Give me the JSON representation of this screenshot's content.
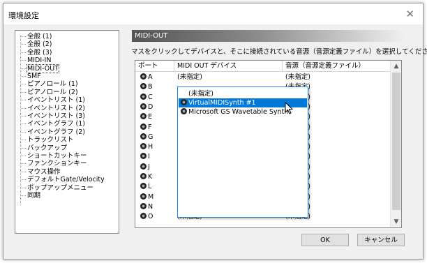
{
  "window": {
    "title": "環境設定"
  },
  "tree": {
    "items": [
      {
        "label": "全般 (1)",
        "selected": false
      },
      {
        "label": "全般 (2)",
        "selected": false
      },
      {
        "label": "全般 (3)",
        "selected": false
      },
      {
        "label": "MIDI-IN",
        "selected": false
      },
      {
        "label": "MIDI-OUT",
        "selected": true
      },
      {
        "label": "SMF",
        "selected": false
      },
      {
        "label": "ピアノロール (1)",
        "selected": false
      },
      {
        "label": "ピアノロール (2)",
        "selected": false
      },
      {
        "label": "イベントリスト (1)",
        "selected": false
      },
      {
        "label": "イベントリスト (2)",
        "selected": false
      },
      {
        "label": "イベントリスト (3)",
        "selected": false
      },
      {
        "label": "イベントグラフ (1)",
        "selected": false
      },
      {
        "label": "イベントグラフ (2)",
        "selected": false
      },
      {
        "label": "トラックリスト",
        "selected": false
      },
      {
        "label": "バックアップ",
        "selected": false
      },
      {
        "label": "ショートカットキー",
        "selected": false
      },
      {
        "label": "ファンクションキー",
        "selected": false
      },
      {
        "label": "マウス操作",
        "selected": false
      },
      {
        "label": "デフォルトGate/Velocity",
        "selected": false
      },
      {
        "label": "ポップアップメニュー",
        "selected": false
      },
      {
        "label": "同期",
        "selected": false
      }
    ]
  },
  "section": {
    "title": "MIDI-OUT",
    "instruction": "マスをクリックしてデバイスと、そこに接続されている音源（音源定義ファイル）を選択してください。"
  },
  "grid": {
    "headers": {
      "port": "ポート",
      "device": "MIDI OUT デバイス",
      "sound": "音源（音源定義ファイル）"
    },
    "rows": [
      {
        "port": "A",
        "device": "(未指定)",
        "sound": "(未指定)"
      },
      {
        "port": "B",
        "device": "",
        "sound": "(未指定)"
      },
      {
        "port": "C",
        "device": "",
        "sound": "(未指定)"
      },
      {
        "port": "D",
        "device": "",
        "sound": "(未指定)"
      },
      {
        "port": "E",
        "device": "",
        "sound": "(未指定)"
      },
      {
        "port": "F",
        "device": "",
        "sound": "(未指定)"
      },
      {
        "port": "G",
        "device": "",
        "sound": "(未指定)"
      },
      {
        "port": "H",
        "device": "",
        "sound": "(未指定)"
      },
      {
        "port": "I",
        "device": "",
        "sound": "(未指定)"
      },
      {
        "port": "J",
        "device": "",
        "sound": "(未指定)"
      },
      {
        "port": "K",
        "device": "",
        "sound": "(未指定)"
      },
      {
        "port": "L",
        "device": "",
        "sound": "(未指定)"
      },
      {
        "port": "M",
        "device": "",
        "sound": "(未指定)"
      },
      {
        "port": "N",
        "device": "",
        "sound": "(未指定)"
      },
      {
        "port": "O",
        "device": "(未指定)",
        "sound": "(未指定)"
      }
    ]
  },
  "dropdown": {
    "options": [
      {
        "label": "(未指定)",
        "icon": false,
        "highlighted": false
      },
      {
        "label": "VirtualMIDISynth #1",
        "icon": true,
        "highlighted": true
      },
      {
        "label": "Microsoft GS Wavetable Synth",
        "icon": true,
        "highlighted": false
      }
    ]
  },
  "buttons": {
    "ok": "OK",
    "cancel": "キャンセル"
  },
  "colors": {
    "highlight": "#0078d7",
    "dropdown_border": "#1c7fe0"
  }
}
